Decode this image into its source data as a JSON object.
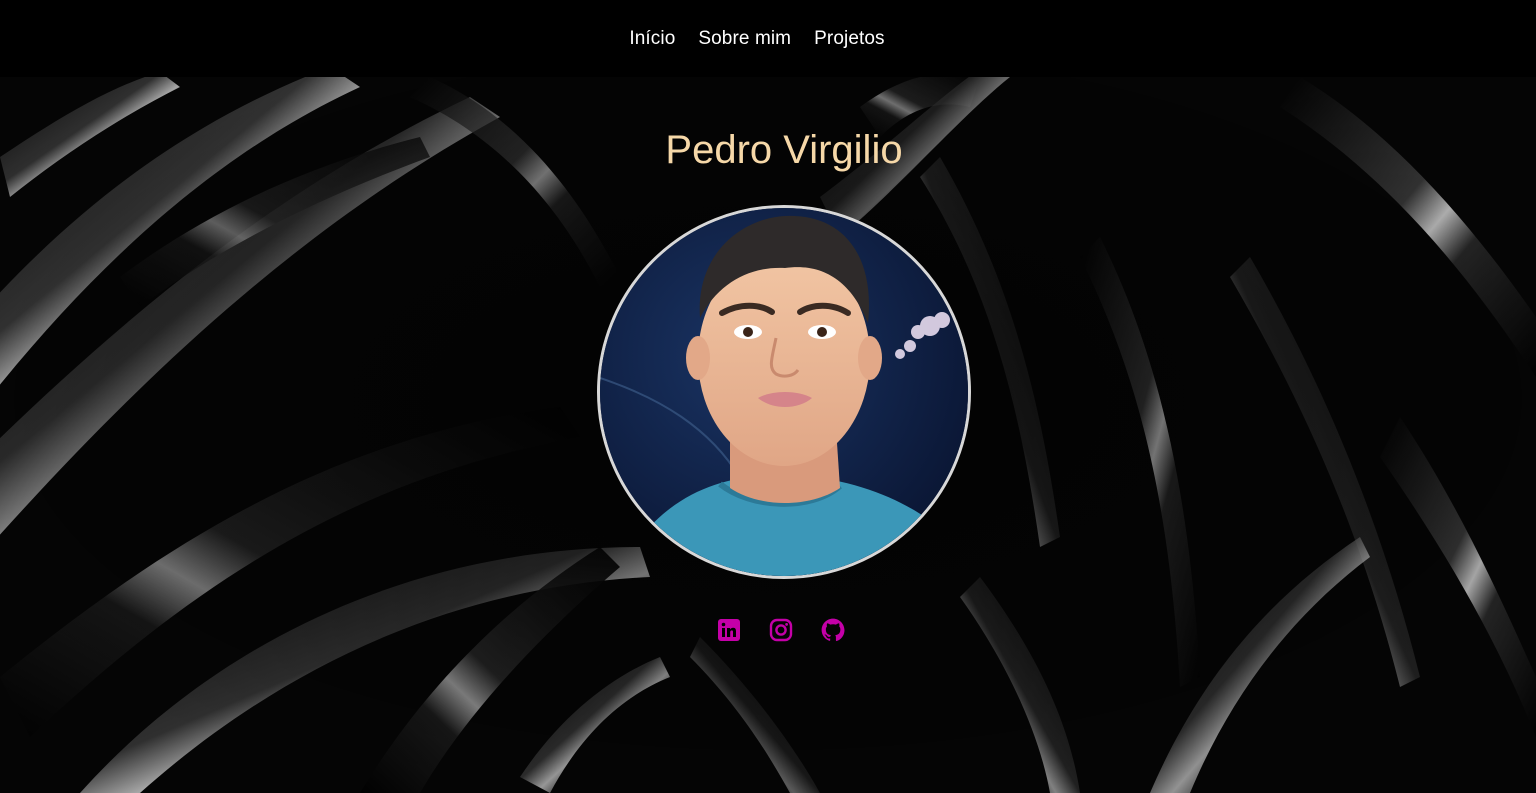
{
  "nav": {
    "items": [
      {
        "label": "Início"
      },
      {
        "label": "Sobre mim"
      },
      {
        "label": "Projetos"
      }
    ]
  },
  "hero": {
    "title": "Pedro Virgilio"
  },
  "socials": [
    {
      "icon": "linkedin-icon"
    },
    {
      "icon": "instagram-icon"
    },
    {
      "icon": "github-icon"
    }
  ],
  "colors": {
    "background": "#000000",
    "title": "#f6d8a8",
    "nav_text": "#ffffff",
    "social_icons": "#c400a8"
  }
}
